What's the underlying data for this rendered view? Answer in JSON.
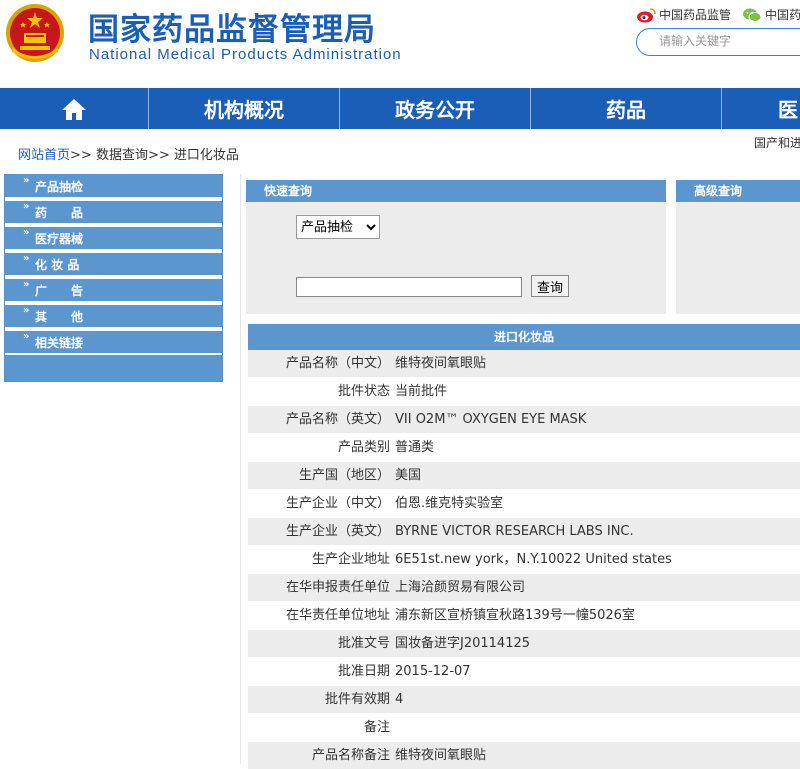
{
  "header": {
    "title": "国家药品监督管理局",
    "subtitle": "National Medical Products Administration",
    "weibo_label": "中国药品监管",
    "wechat_label": "中国药",
    "search_placeholder": "请输入关键字"
  },
  "nav": {
    "items": [
      {
        "label": "机构概况"
      },
      {
        "label": "政务公开"
      },
      {
        "label": "药品"
      },
      {
        "label": "医"
      }
    ]
  },
  "breadcrumb": {
    "home": "网站首页",
    "sep1": ">>",
    "level2": "数据查询",
    "sep2": ">>",
    "current": "进口化妆品"
  },
  "top_right_note": "国产和进",
  "sidebar": {
    "items": [
      {
        "label": "产品抽检"
      },
      {
        "label": "药　　品"
      },
      {
        "label": "医疗器械"
      },
      {
        "label": "化 妆 品"
      },
      {
        "label": "广　　告"
      },
      {
        "label": "其　　他"
      },
      {
        "label": "相关链接"
      }
    ]
  },
  "quick_query": {
    "title": "快速查询",
    "select_value": "产品抽检",
    "input_value": "",
    "button_label": "查询"
  },
  "advanced_query": {
    "title": "高级查询"
  },
  "result": {
    "title": "进口化妆品",
    "rows": [
      {
        "label": "产品名称（中文）",
        "value": "维特夜间氧眼贴"
      },
      {
        "label": "批件状态",
        "value": "当前批件"
      },
      {
        "label": "产品名称（英文）",
        "value": "VII O2M™ OXYGEN EYE MASK"
      },
      {
        "label": "产品类别",
        "value": "普通类"
      },
      {
        "label": "生产国（地区）",
        "value": "美国"
      },
      {
        "label": "生产企业（中文）",
        "value": "伯恩.维克特实验室"
      },
      {
        "label": "生产企业（英文）",
        "value": "BYRNE VICTOR RESEARCH LABS INC."
      },
      {
        "label": "生产企业地址",
        "value": "6E51st.new york，N.Y.10022 United states"
      },
      {
        "label": "在华申报责任单位",
        "value": "上海洽颜贸易有限公司"
      },
      {
        "label": "在华责任单位地址",
        "value": "浦东新区宣桥镇宣秋路139号一幢5026室"
      },
      {
        "label": "批准文号",
        "value": "国妆备进字J20114125"
      },
      {
        "label": "批准日期",
        "value": "2015-12-07"
      },
      {
        "label": "批件有效期",
        "value": "4"
      },
      {
        "label": "备注",
        "value": ""
      },
      {
        "label": "产品名称备注",
        "value": "维特夜间氧眼贴"
      }
    ]
  },
  "colors": {
    "brand_blue": "#1a5eb8",
    "panel_blue": "#5b96cf",
    "row_gray": "#ececec"
  }
}
